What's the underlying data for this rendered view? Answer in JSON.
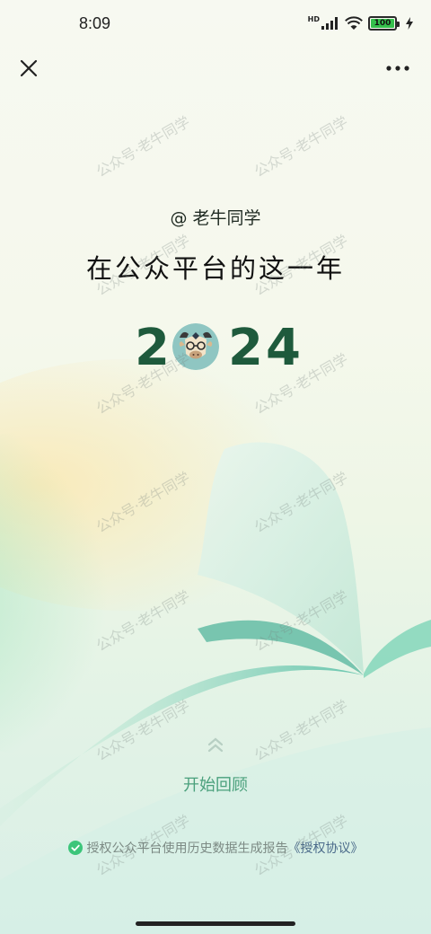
{
  "status_bar": {
    "time": "8:09",
    "battery_level": "100",
    "network_badge": "HD",
    "icons": [
      "signal-icon",
      "wifi-icon",
      "battery-icon",
      "charging-icon"
    ]
  },
  "nav": {
    "close_icon": "close-icon",
    "more_icon": "more-icon"
  },
  "main": {
    "handle": "@ 老牛同学",
    "headline": "在公众平台的这一年",
    "year_digits": [
      "2",
      "2",
      "4"
    ],
    "avatar_icon": "bull-mascot-avatar"
  },
  "actions": {
    "start_label": "开始回顾",
    "swipe_icon": "chevron-up-icon"
  },
  "consent": {
    "text": "授权公众平台使用历史数据生成报告",
    "link": "《授权协议》"
  },
  "watermark": "公众号·老牛同学",
  "colors": {
    "accent": "#1e5a3c",
    "start": "#4aa07c",
    "check": "#3cc57a",
    "link": "#4a6a8a"
  }
}
